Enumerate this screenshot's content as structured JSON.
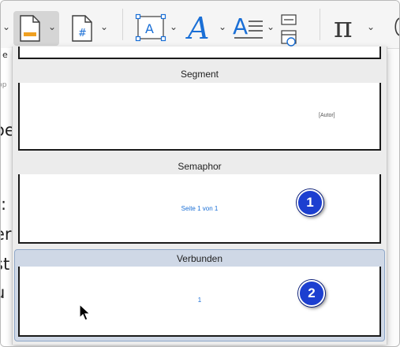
{
  "ribbon": {
    "buttons": [
      {
        "name": "header-footer-button",
        "icon": "page-header-icon"
      },
      {
        "name": "page-number-button",
        "icon": "page-number-icon",
        "glyph": "#"
      },
      {
        "name": "text-box-button",
        "icon": "text-box-icon",
        "glyph": "A"
      },
      {
        "name": "word-art-button",
        "icon": "word-art-icon",
        "glyph": "A"
      },
      {
        "name": "drop-cap-button",
        "icon": "drop-cap-icon",
        "glyph": "A"
      },
      {
        "name": "date-time-button",
        "icon": "date-time-icon"
      },
      {
        "name": "equation-button",
        "icon": "pi-icon",
        "glyph": "π"
      }
    ]
  },
  "document_fragments": [
    "e",
    "pp",
    "oe",
    ":",
    "er",
    "st",
    "u"
  ],
  "gallery": {
    "items": [
      {
        "label": "Segment",
        "preview_text": "[Autor]"
      },
      {
        "label": "Semaphor",
        "preview_text": "Seite 1 von 1"
      },
      {
        "label": "Verbunden",
        "preview_text": "1",
        "selected": true
      }
    ],
    "callouts": [
      "1",
      "2"
    ]
  },
  "colors": {
    "accent_blue": "#1a6fd6",
    "badge_blue": "#1c3fd0",
    "selected_bg": "#cfd8e6"
  }
}
